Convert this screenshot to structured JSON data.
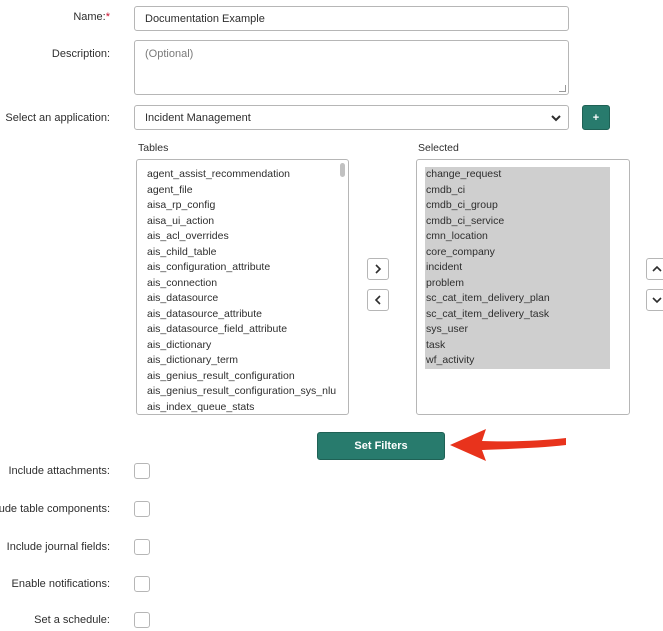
{
  "form": {
    "name_label": "Name:",
    "name_required_mark": "*",
    "name_value": "Documentation Example",
    "description_label": "Description:",
    "description_placeholder": "(Optional)",
    "application_label": "Select an application:",
    "application_value": "Incident Management",
    "add_button_label": "+"
  },
  "tables": {
    "title": "Tables",
    "items": [
      "agent_assist_recommendation",
      "agent_file",
      "aisa_rp_config",
      "aisa_ui_action",
      "ais_acl_overrides",
      "ais_child_table",
      "ais_configuration_attribute",
      "ais_connection",
      "ais_datasource",
      "ais_datasource_attribute",
      "ais_datasource_field_attribute",
      "ais_dictionary",
      "ais_dictionary_term",
      "ais_genius_result_configuration",
      "ais_genius_result_configuration_sys_nlu",
      "ais_index_queue_stats"
    ]
  },
  "selected": {
    "title": "Selected",
    "items": [
      "change_request",
      "cmdb_ci",
      "cmdb_ci_group",
      "cmdb_ci_service",
      "cmn_location",
      "core_company",
      "incident",
      "problem",
      "sc_cat_item_delivery_plan",
      "sc_cat_item_delivery_task",
      "sys_user",
      "task",
      "wf_activity"
    ]
  },
  "actions": {
    "set_filters_label": "Set Filters"
  },
  "options": [
    {
      "label": "Include attachments:"
    },
    {
      "label": "Include table components:"
    },
    {
      "label": "Include journal fields:"
    },
    {
      "label": "Enable notifications:"
    },
    {
      "label": "Set a schedule:"
    }
  ],
  "colors": {
    "accent": "#287b6d",
    "arrow": "#e8331c",
    "selected_bg": "#cfcfcf",
    "required": "#c8102e"
  },
  "icons": {
    "move_right": "chevron-right-icon",
    "move_left": "chevron-left-icon",
    "move_up": "chevron-up-icon",
    "move_down": "chevron-down-icon",
    "dropdown": "chevron-down-icon",
    "annotation": "red-arrow-icon"
  }
}
